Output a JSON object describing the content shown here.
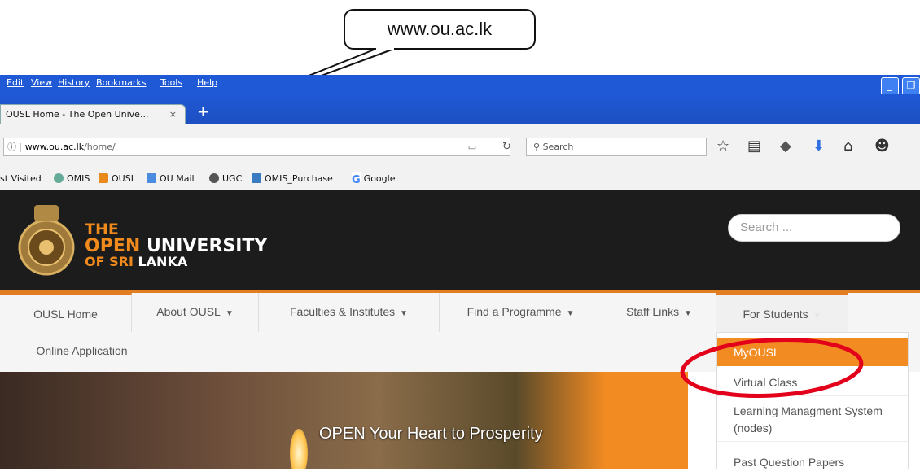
{
  "callout": {
    "text": "www.ou.ac.lk"
  },
  "menubar": {
    "items": [
      "Edit",
      "View",
      "History",
      "Bookmarks",
      "Tools",
      "Help"
    ]
  },
  "tab": {
    "title": "OUSL Home - The Open Unive...",
    "close": "×",
    "new_tab": "+"
  },
  "address_bar": {
    "info_icon": "ⓘ",
    "url_host": "www.ou.ac.lk",
    "url_path": "/home/"
  },
  "search_bar": {
    "placeholder": "Search"
  },
  "bookmarks": {
    "items": [
      "st Visited",
      "OMIS",
      "OUSL",
      "OU Mail",
      "UGC",
      "OMIS_Purchase",
      "Google"
    ]
  },
  "site": {
    "brand": {
      "line1": "THE",
      "line2_a": "OPEN",
      "line2_b": " UNIVERSITY",
      "line3_a": "OF SRI",
      "line3_b": " LANKA"
    },
    "search_placeholder": "Search ...",
    "nav": [
      {
        "label": "OUSL Home",
        "caret": ""
      },
      {
        "label": "About OUSL",
        "caret": "▼"
      },
      {
        "label": "Faculties & Institutes",
        "caret": "▼"
      },
      {
        "label": "Find a Programme",
        "caret": "▼"
      },
      {
        "label": "Staff Links",
        "caret": "▼"
      },
      {
        "label": "For Students",
        "caret": "▼"
      },
      {
        "label": "Online Application",
        "caret": ""
      }
    ],
    "dropdown": [
      "MyOUSL",
      "Virtual Class",
      "Learning Managment System (nodes)",
      "Past Question Papers"
    ],
    "hero_text": "OPEN Your Heart to Prosperity"
  },
  "colors": {
    "firefox_blue": "#1f59d6",
    "site_dark": "#1c1c1c",
    "accent_orange": "#f28b22",
    "highlight_red": "#e3001b"
  }
}
